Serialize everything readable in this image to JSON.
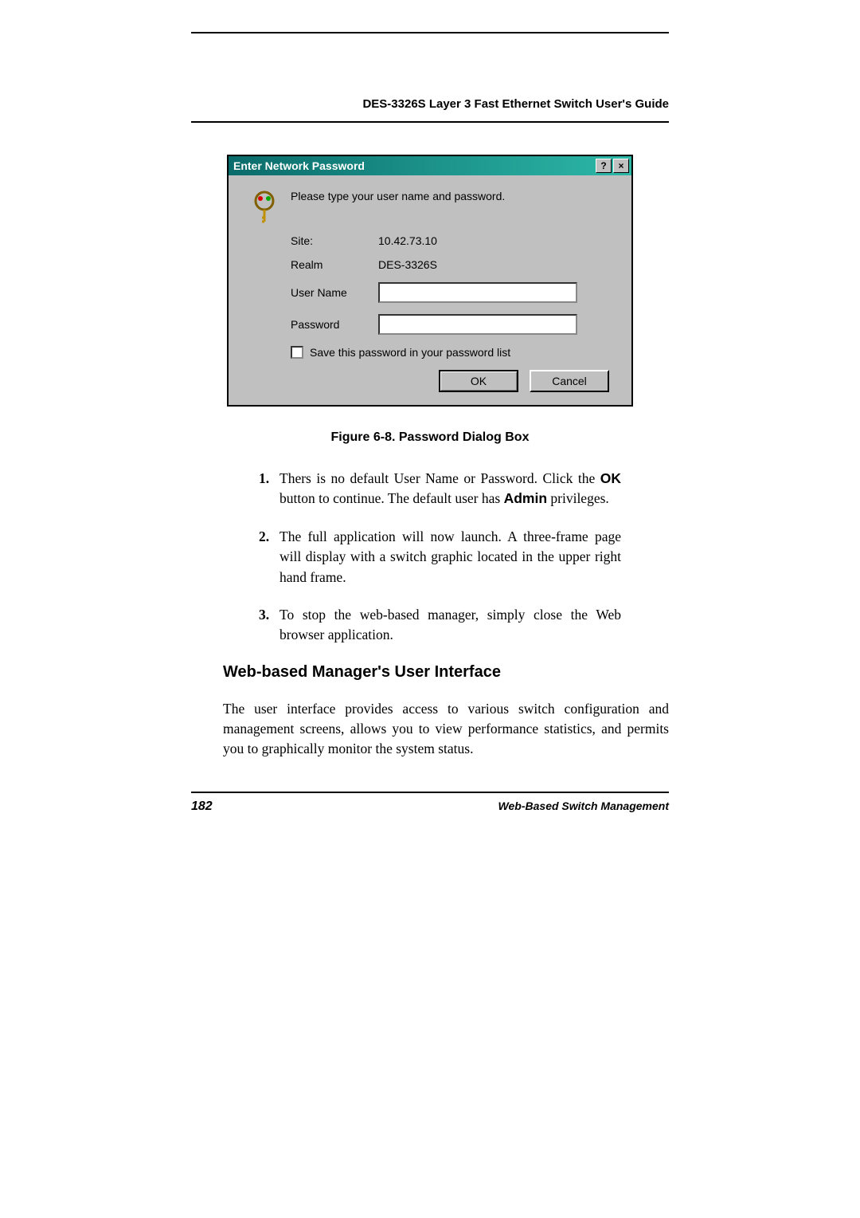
{
  "header": {
    "title": "DES-3326S Layer 3 Fast Ethernet Switch User's Guide"
  },
  "dialog": {
    "title": "Enter Network Password",
    "instruction": "Please type your user name and password.",
    "site_label": "Site:",
    "site_value": "10.42.73.10",
    "realm_label": "Realm",
    "realm_value": "DES-3326S",
    "username_label": "User Name",
    "password_label": "Password",
    "save_checkbox_label": "Save this password in your password list",
    "ok_label": "OK",
    "cancel_label": "Cancel"
  },
  "figure_caption": "Figure 6-8.  Password Dialog Box",
  "list": {
    "items": [
      {
        "num": "1.",
        "text_pre": "Thers is no default User Name or Password.  Click the ",
        "bold1": "OK",
        "text_mid": " button to continue.  The default user has ",
        "bold2": "Admin",
        "text_post": " privileges."
      },
      {
        "num": "2.",
        "text": "The full application will now launch.  A three-frame page will display with a switch graphic located in the upper right hand frame."
      },
      {
        "num": "3.",
        "text": "To stop the web-based manager, simply close the Web browser application."
      }
    ]
  },
  "section": {
    "heading": "Web-based Manager's User Interface",
    "paragraph": "The user interface provides access to various switch configuration and management screens, allows you to view performance statistics, and permits you to graphically monitor the system status."
  },
  "footer": {
    "page": "182",
    "title": "Web-Based Switch Management"
  }
}
